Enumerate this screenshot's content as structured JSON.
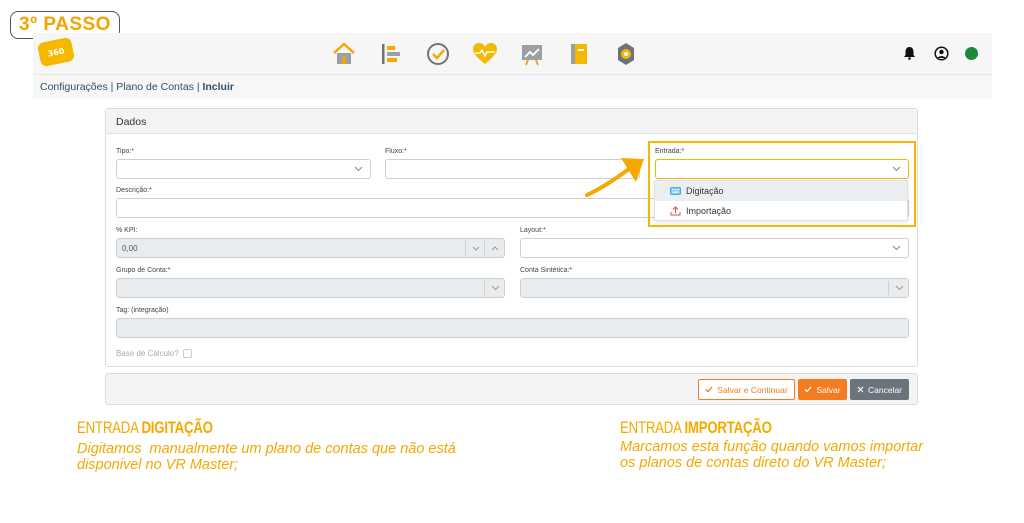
{
  "step_label": "3º PASSO",
  "logo_text": "360",
  "nav": {
    "icons": [
      "home-icon",
      "list-icon",
      "clock-icon",
      "heart-pulse-icon",
      "chart-icon",
      "notebook-icon",
      "settings-icon"
    ]
  },
  "header_right": {
    "icons": [
      "bell-icon",
      "user-icon",
      "status-online-icon"
    ],
    "status_color": "#1b8a3c"
  },
  "breadcrumb": {
    "path": "Configurações | Plano de Contas | ",
    "current": "Incluir"
  },
  "panel": {
    "title": "Dados"
  },
  "form": {
    "tipo_label": "Tipo:*",
    "fluxo_label": "Fluxo:*",
    "entrada_label": "Entrada:*",
    "descricao_label": "Descrição:*",
    "kpi_label": "% KPI:",
    "kpi_value": "0,00",
    "layout_label": "Layout:*",
    "grupo_label": "Grupo de Conta:*",
    "sintetica_label": "Conta Sintética:*",
    "tag_label": "Tag: (integração)",
    "base_label": "Base de Cálculo?"
  },
  "entrada_options": [
    {
      "label": "Digitação",
      "icon": "keyboard-icon"
    },
    {
      "label": "Importação",
      "icon": "upload-icon"
    }
  ],
  "buttons": {
    "save_continue": "Salvar e Continuar",
    "save": "Salvar",
    "cancel": "Cancelar"
  },
  "annotations": {
    "left_title_a": "ENTRADA ",
    "left_title_b": "DIGITAÇÃO",
    "left_text_1": "Digitamos  manualmente um plano de contas que não está",
    "left_text_2": "disponivel no VR Master;",
    "right_title_a": "ENTRADA ",
    "right_title_b": "IMPORTAÇÃO",
    "right_text_1": "Marcamos esta função quando vamos importar",
    "right_text_2": "os planos de contas direto do VR Master;"
  },
  "colors": {
    "accent": "#f5a800",
    "button_orange": "#f47c20",
    "button_gray": "#6b747c"
  }
}
